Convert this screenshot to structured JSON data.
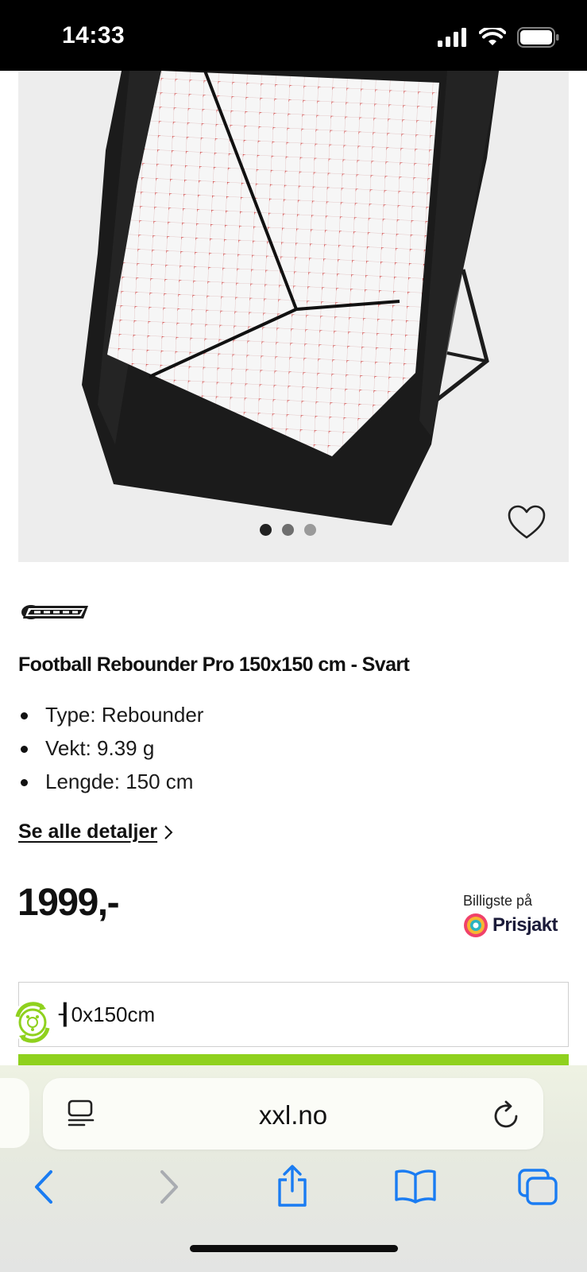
{
  "status_bar": {
    "time": "14:33"
  },
  "product": {
    "carousel": {
      "total": 3,
      "active": 1
    },
    "brand_logo_text": "GOALZ",
    "title": "Football Rebounder Pro 150x150 cm - Svart",
    "specs": [
      "Type: Rebounder",
      "Vekt: 9.39 g",
      "Lengde: 150 cm"
    ],
    "details_link": "Se alle detaljer",
    "price": "1999,-",
    "prisjakt": {
      "label": "Billigste på",
      "brand": "Prisjakt"
    },
    "variant": "┨0x150cm"
  },
  "browser": {
    "url": "xxl.no"
  },
  "colors": {
    "accent_green": "#8fd11e",
    "ios_blue": "#1a7cf2",
    "status_bar": "#000000"
  }
}
